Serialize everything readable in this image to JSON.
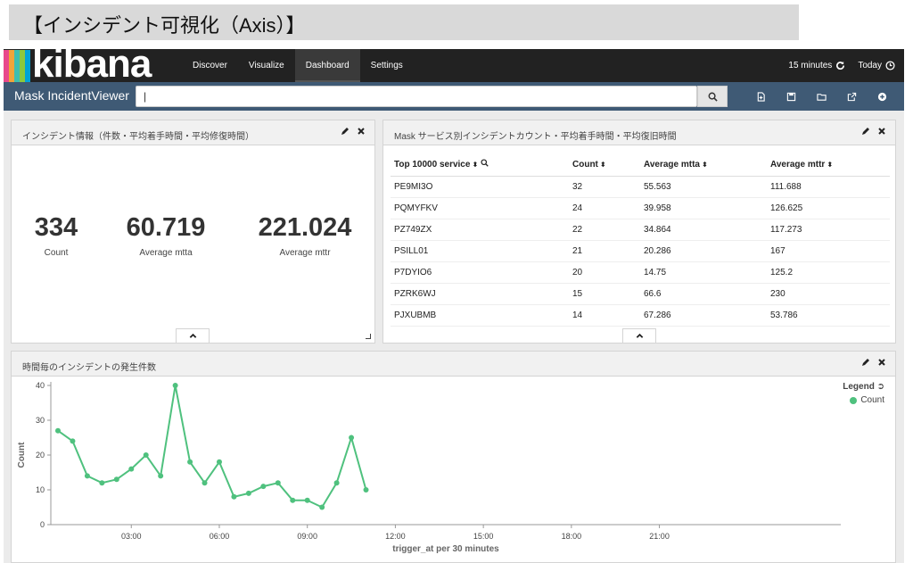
{
  "slide": {
    "title": "【インシデント可視化（Axis）】"
  },
  "app": {
    "logo_text": "kibana",
    "logo_colors": [
      "#e8488b",
      "#f0a43a",
      "#3ebeb0",
      "#8cc83e",
      "#00a3d8"
    ],
    "nav": [
      "Discover",
      "Visualize",
      "Dashboard",
      "Settings"
    ],
    "active_nav": "Dashboard",
    "time_range": "15 minutes",
    "today_label": "Today"
  },
  "subbar": {
    "dashboard_name": "Mask IncidentViewer",
    "query_value": ""
  },
  "panel_metrics": {
    "title": "インシデント情報（件数・平均着手時間・平均修復時間）",
    "metrics": [
      {
        "value": "334",
        "label": "Count"
      },
      {
        "value": "60.719",
        "label": "Average mtta"
      },
      {
        "value": "221.024",
        "label": "Average mttr"
      }
    ]
  },
  "panel_table": {
    "title": "Mask サービス別インシデントカウント・平均着手時間・平均復旧時間",
    "columns": [
      "Top 10000 service",
      "Count",
      "Average mtta",
      "Average mttr"
    ],
    "rows": [
      [
        "PE9MI3O",
        "32",
        "55.563",
        "111.688"
      ],
      [
        "PQMYFKV",
        "24",
        "39.958",
        "126.625"
      ],
      [
        "PZ749ZX",
        "22",
        "34.864",
        "117.273"
      ],
      [
        "PSILL01",
        "21",
        "20.286",
        "167"
      ],
      [
        "P7DYIO6",
        "20",
        "14.75",
        "125.2"
      ],
      [
        "PZRK6WJ",
        "15",
        "66.6",
        "230"
      ],
      [
        "PJXUBMB",
        "14",
        "67.286",
        "53.786"
      ]
    ]
  },
  "panel_chart": {
    "title": "時間毎のインシデントの発生件数",
    "legend_title": "Legend",
    "accent": "#4fc17e"
  },
  "chart_data": {
    "type": "line",
    "xlabel": "trigger_at per 30 minutes",
    "ylabel": "Count",
    "ylim": [
      0,
      40
    ],
    "yticks": [
      0,
      10,
      20,
      30,
      40
    ],
    "xticks": [
      "03:00",
      "06:00",
      "09:00",
      "12:00",
      "15:00",
      "18:00",
      "21:00"
    ],
    "grid": false,
    "legend_position": "top-right",
    "x": [
      "00:30",
      "01:00",
      "01:30",
      "02:00",
      "02:30",
      "03:00",
      "03:30",
      "04:00",
      "04:30",
      "05:00",
      "05:30",
      "06:00",
      "06:30",
      "07:00",
      "07:30",
      "08:00",
      "08:30",
      "09:00",
      "09:30",
      "10:00",
      "10:30",
      "11:00",
      "11:30"
    ],
    "series": [
      {
        "name": "Count",
        "values": [
          27,
          24,
          14,
          12,
          13,
          16,
          20,
          14,
          40,
          18,
          12,
          18,
          8,
          9,
          11,
          12,
          7,
          7,
          5,
          12,
          25,
          10
        ]
      }
    ]
  }
}
